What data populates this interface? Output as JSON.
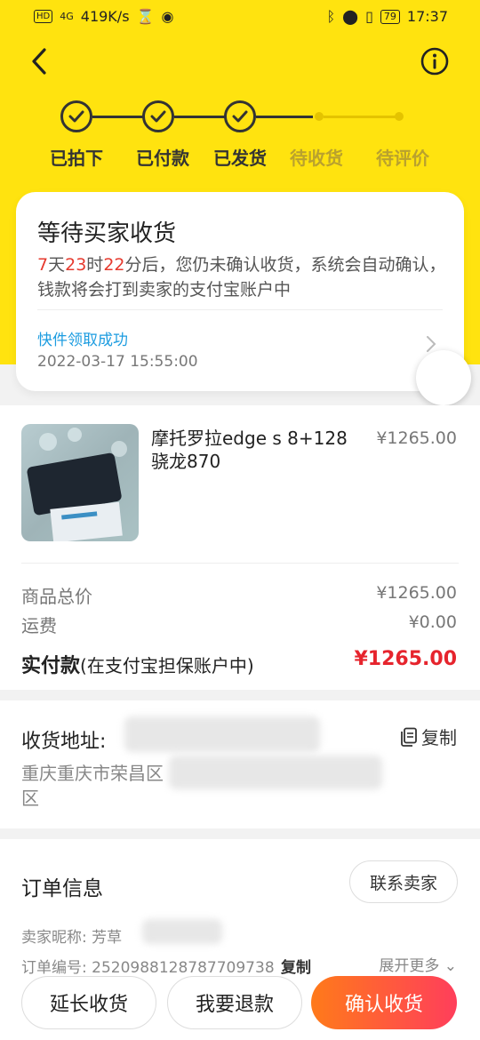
{
  "status_bar": {
    "hd": "HD",
    "network": "4G",
    "speed": "419K/s",
    "battery": "79",
    "time": "17:37"
  },
  "nav": {
    "back_icon": "chevron-left-icon",
    "info_icon": "info-icon"
  },
  "steps": [
    {
      "label": "已拍下",
      "done": true
    },
    {
      "label": "已付款",
      "done": true
    },
    {
      "label": "已发货",
      "done": true
    },
    {
      "label": "待收货",
      "done": false
    },
    {
      "label": "待评价",
      "done": false
    }
  ],
  "status_card": {
    "title": "等待买家收货",
    "days": "7",
    "days_unit": "天",
    "hours": "23",
    "hours_unit": "时",
    "minutes": "22",
    "desc_rest": "分后，您仍未确认收货，系统会自动确认，钱款将会打到卖家的支付宝账户中",
    "shipping_status": "快件领取成功",
    "shipping_time": "2022-03-17 15:55:00"
  },
  "order": {
    "product_title": "摩托罗拉edge s 8+128骁龙870",
    "product_price": "¥1265.00",
    "total_label": "商品总价",
    "total_value": "¥1265.00",
    "shipping_label": "运费",
    "shipping_value": "¥0.00",
    "paid_label_main": "实付款",
    "paid_label_note": "(在支付宝担保账户中)",
    "paid_value": "¥1265.00"
  },
  "address": {
    "label": "收货地址: ",
    "text": "重庆重庆市荣昌区",
    "text_line2": "区",
    "copy": "复制"
  },
  "order_info": {
    "title": "订单信息",
    "contact": "联系卖家",
    "seller_label": "卖家昵称: 芳草",
    "order_no_label": "订单编号: 2520988128787709738",
    "copy": "复制",
    "more": "展开更多"
  },
  "bottom": {
    "extend": "延长收货",
    "refund": "我要退款",
    "confirm": "确认收货"
  },
  "colors": {
    "brand_yellow": "#ffe30f",
    "countdown_red": "#e63a2e",
    "paid_red": "#e6242d",
    "link_blue": "#1c9ce0",
    "cta_gradient_start": "#ff7a1a",
    "cta_gradient_end": "#ff3e5b"
  }
}
